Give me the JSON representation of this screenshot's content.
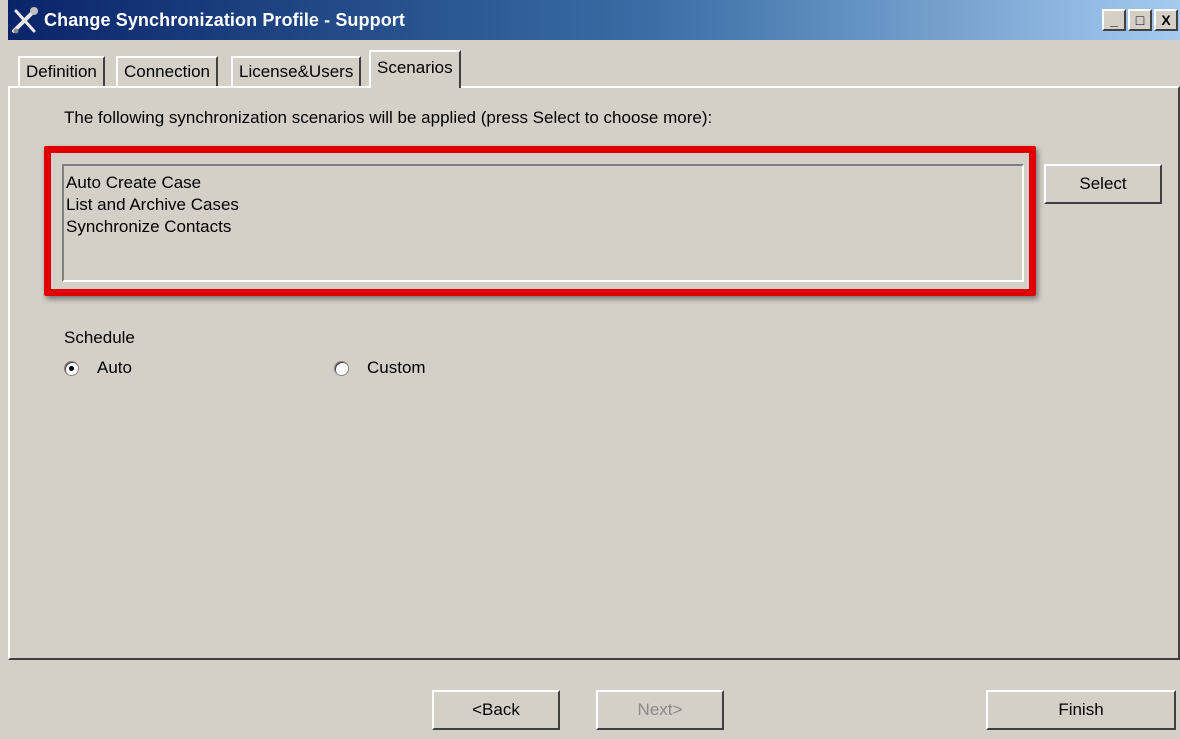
{
  "window": {
    "title": "Change Synchronization Profile - Support",
    "controls": {
      "minimize": "_",
      "maximize": "□",
      "close": "X"
    }
  },
  "tabs": [
    {
      "label": "Definition",
      "active": false
    },
    {
      "label": "Connection",
      "active": false
    },
    {
      "label": "License&Users",
      "active": false
    },
    {
      "label": "Scenarios",
      "active": true
    }
  ],
  "scenarios": {
    "intro": "The following synchronization scenarios will be applied (press Select to choose more):",
    "items": [
      "Auto Create Case",
      "List and Archive Cases",
      "Synchronize Contacts"
    ],
    "select_label": "Select",
    "highlight_color": "#e10000"
  },
  "schedule": {
    "label": "Schedule",
    "options": [
      {
        "label": "Auto",
        "selected": true
      },
      {
        "label": "Custom",
        "selected": false
      }
    ]
  },
  "footer": {
    "back_label": "<Back",
    "next_label": "Next>",
    "next_enabled": false,
    "finish_label": "Finish"
  }
}
